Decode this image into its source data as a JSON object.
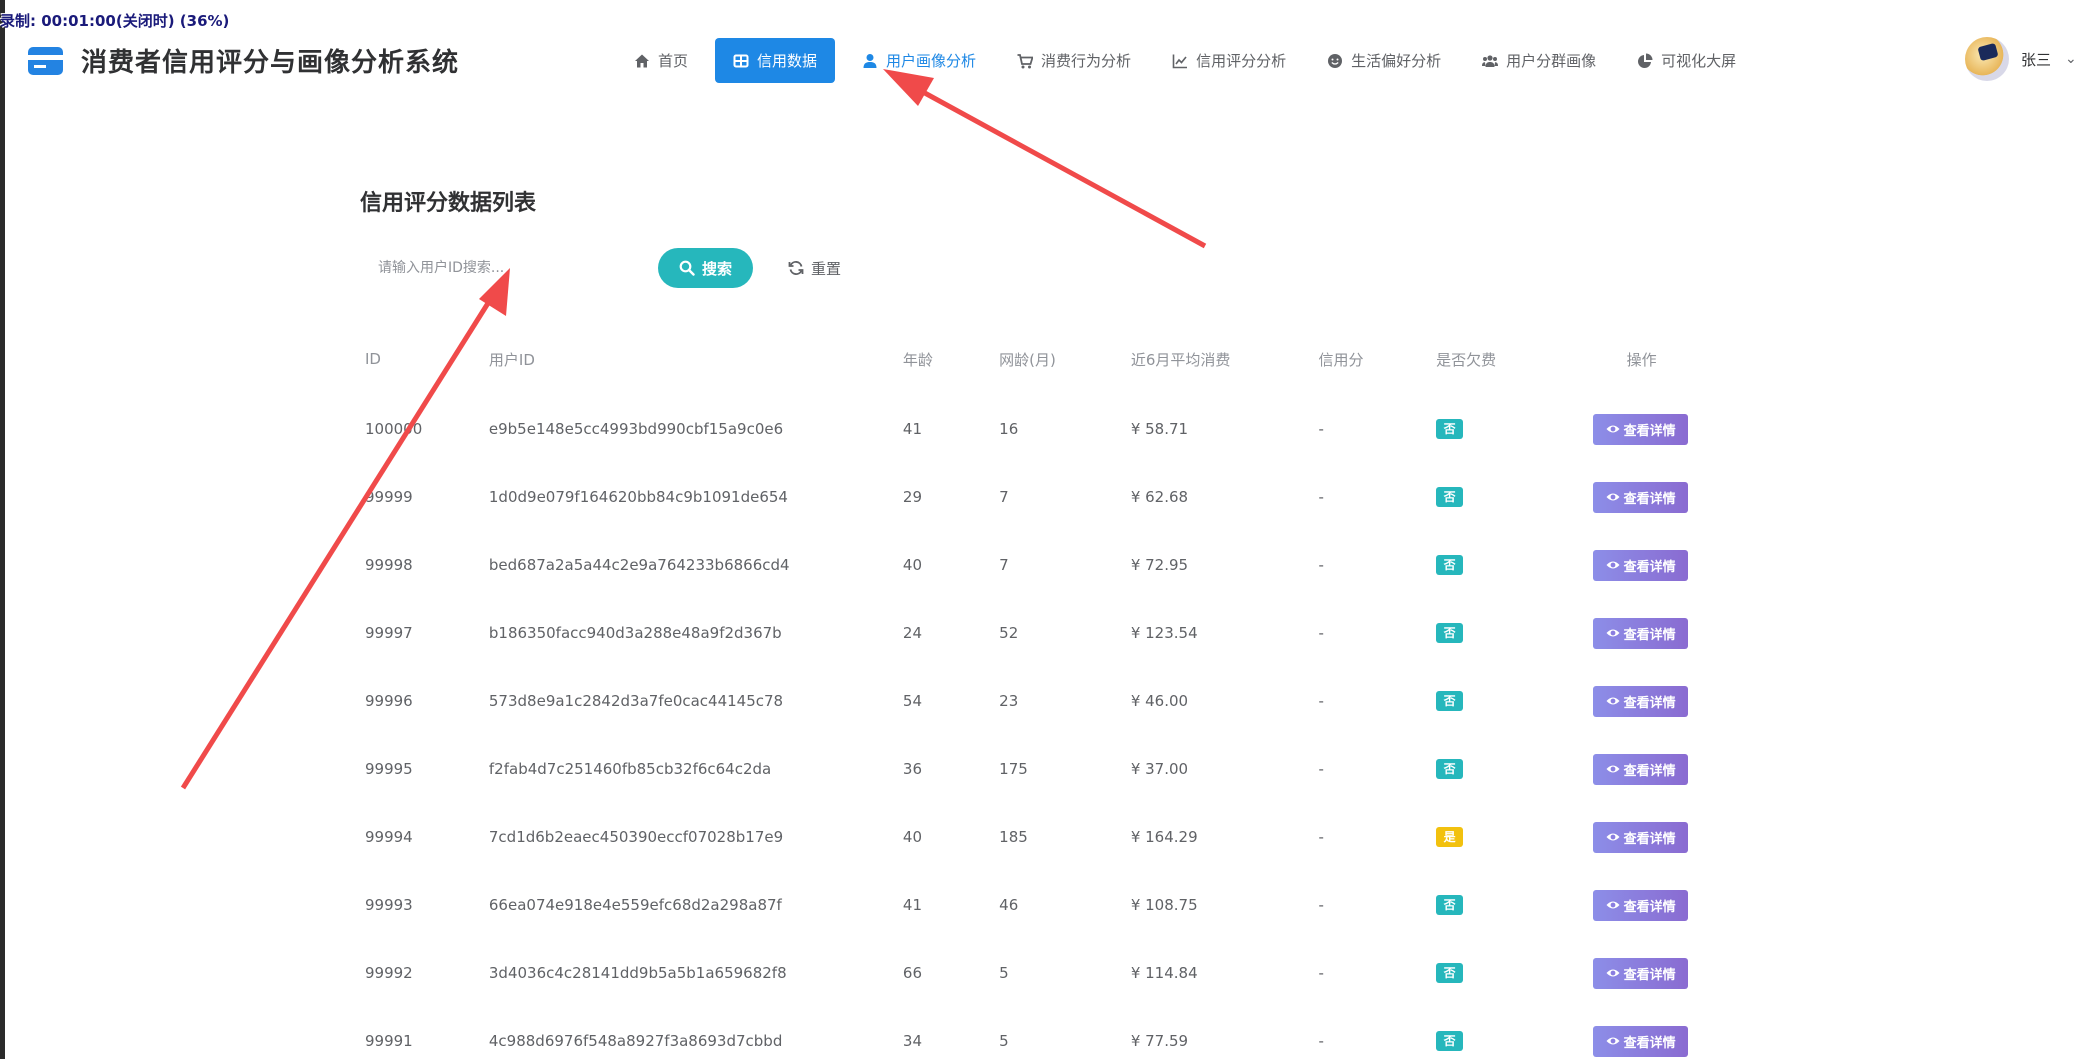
{
  "recording_overlay": "录制: 00:01:00(关闭时) (36%)",
  "app": {
    "title": "消费者信用评分与画像分析系统",
    "accent_color": "#1e88e5"
  },
  "nav": {
    "items": [
      {
        "label": "首页",
        "icon": "home-icon"
      },
      {
        "label": "信用数据",
        "icon": "table-icon"
      },
      {
        "label": "用户画像分析",
        "icon": "user-icon"
      },
      {
        "label": "消费行为分析",
        "icon": "cart-icon"
      },
      {
        "label": "信用评分分析",
        "icon": "line-chart-icon"
      },
      {
        "label": "生活偏好分析",
        "icon": "smile-icon"
      },
      {
        "label": "用户分群画像",
        "icon": "users-icon"
      },
      {
        "label": "可视化大屏",
        "icon": "pie-chart-icon"
      }
    ],
    "active": "信用数据",
    "hover": "用户画像分析"
  },
  "user": {
    "name": "张三"
  },
  "main": {
    "title": "信用评分数据列表",
    "search_placeholder": "请输入用户ID搜索...",
    "search_label": "搜索",
    "reset_label": "重置"
  },
  "table": {
    "headers": [
      "ID",
      "用户ID",
      "年龄",
      "网龄(月)",
      "近6月平均消费",
      "信用分",
      "是否欠费",
      "操作"
    ],
    "detail_label": "查看详情",
    "rows": [
      {
        "id": "100000",
        "uid": "e9b5e148e5cc4993bd990cbf15a9c0e6",
        "age": "41",
        "net": "16",
        "avg": "¥ 58.71",
        "score": "-",
        "owe": "否"
      },
      {
        "id": "99999",
        "uid": "1d0d9e079f164620bb84c9b1091de654",
        "age": "29",
        "net": "7",
        "avg": "¥ 62.68",
        "score": "-",
        "owe": "否"
      },
      {
        "id": "99998",
        "uid": "bed687a2a5a44c2e9a764233b6866cd4",
        "age": "40",
        "net": "7",
        "avg": "¥ 72.95",
        "score": "-",
        "owe": "否"
      },
      {
        "id": "99997",
        "uid": "b186350facc940d3a288e48a9f2d367b",
        "age": "24",
        "net": "52",
        "avg": "¥ 123.54",
        "score": "-",
        "owe": "否"
      },
      {
        "id": "99996",
        "uid": "573d8e9a1c2842d3a7fe0cac44145c78",
        "age": "54",
        "net": "23",
        "avg": "¥ 46.00",
        "score": "-",
        "owe": "否"
      },
      {
        "id": "99995",
        "uid": "f2fab4d7c251460fb85cb32f6c64c2da",
        "age": "36",
        "net": "175",
        "avg": "¥ 37.00",
        "score": "-",
        "owe": "否"
      },
      {
        "id": "99994",
        "uid": "7cd1d6b2eaec450390eccf07028b17e9",
        "age": "40",
        "net": "185",
        "avg": "¥ 164.29",
        "score": "-",
        "owe": "是"
      },
      {
        "id": "99993",
        "uid": "66ea074e918e4e559efc68d2a298a87f",
        "age": "41",
        "net": "46",
        "avg": "¥ 108.75",
        "score": "-",
        "owe": "否"
      },
      {
        "id": "99992",
        "uid": "3d4036c4c28141dd9b5a5b1a659682f8",
        "age": "66",
        "net": "5",
        "avg": "¥ 114.84",
        "score": "-",
        "owe": "否"
      },
      {
        "id": "99991",
        "uid": "4c988d6976f548a8927f3a8693d7cbbd",
        "age": "34",
        "net": "5",
        "avg": "¥ 77.59",
        "score": "-",
        "owe": "否"
      }
    ]
  },
  "colors": {
    "search_button": "#26b7bc",
    "tag_no": "#26b7bc",
    "tag_yes": "#f2c10e",
    "detail_button": "#8a7de0",
    "annotation_arrow": "#f04a4a"
  }
}
